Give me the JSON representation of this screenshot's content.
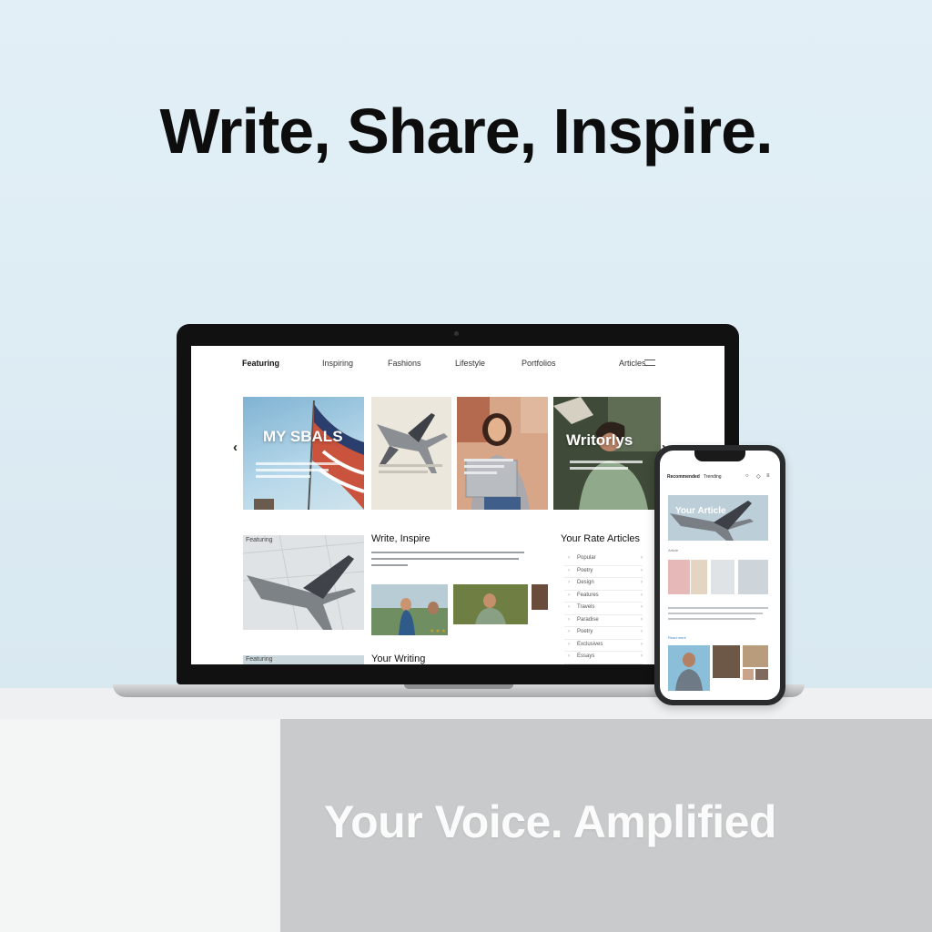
{
  "hero": {
    "headline": "Write, Share, Inspire.",
    "tagline": "Your Voice. Amplified"
  },
  "laptop": {
    "nav": {
      "brand": "Featuring",
      "items": [
        "Inspiring",
        "Fashions",
        "Lifestyle",
        "Portfolios"
      ],
      "right": "Articles"
    },
    "carousel": {
      "cards": [
        {
          "title": "MY SBALS",
          "image": "flag-sky-photo"
        },
        {
          "title": "",
          "image": "airplane-photo"
        },
        {
          "title": "",
          "image": "woman-laptop-photo"
        },
        {
          "title": "Writorlys",
          "image": "woman-phone-photo"
        }
      ]
    },
    "section2": {
      "left_label": "Featuring",
      "title": "Write, Inspire",
      "stars": "★★★"
    },
    "sidebar": {
      "title": "Your Rate Articles",
      "items": [
        "Popular",
        "Poetry",
        "Design",
        "Features",
        "Travels",
        "Paradise",
        "Poetry",
        "Exclusives",
        "Essays"
      ]
    },
    "section3": {
      "left_label": "Featuring",
      "title": "Your Writing"
    }
  },
  "phone": {
    "nav": {
      "left": "Recommended",
      "center": "Trending"
    },
    "hero_title": "Your Article",
    "section_label": "Article",
    "more_link": "Read more"
  },
  "colors": {
    "background": "#dcebf3",
    "headline": "#0d0d0d",
    "tagline": "#fbfbfb",
    "link": "#3b82c4"
  }
}
